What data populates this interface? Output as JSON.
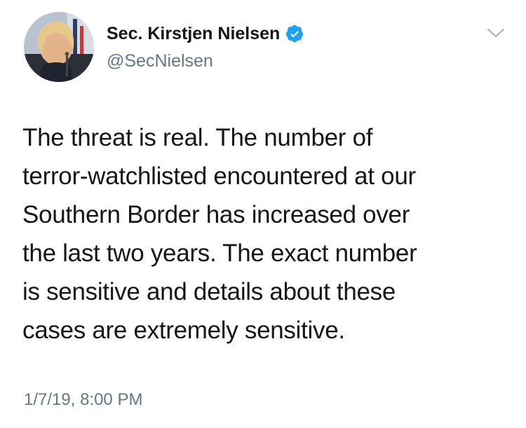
{
  "author": {
    "display_name": "Sec. Kirstjen Nielsen",
    "handle": "@SecNielsen",
    "verified": true,
    "avatar_icon": "profile-photo-icon"
  },
  "tweet": {
    "text_lines": [
      "The threat is real. The number of",
      "terror-watchlisted encountered at our",
      "Southern Border has increased over",
      "the last two years. The exact number",
      "is sensitive and details about these",
      "cases are extremely sensitive."
    ],
    "timestamp": "1/7/19, 8:00 PM"
  },
  "icons": {
    "verified": "verified-badge-icon",
    "menu": "chevron-down-icon"
  },
  "colors": {
    "text_primary": "#14171a",
    "text_secondary": "#657786",
    "verified_blue": "#1da1f2",
    "caret_gray": "#aab8c2"
  }
}
